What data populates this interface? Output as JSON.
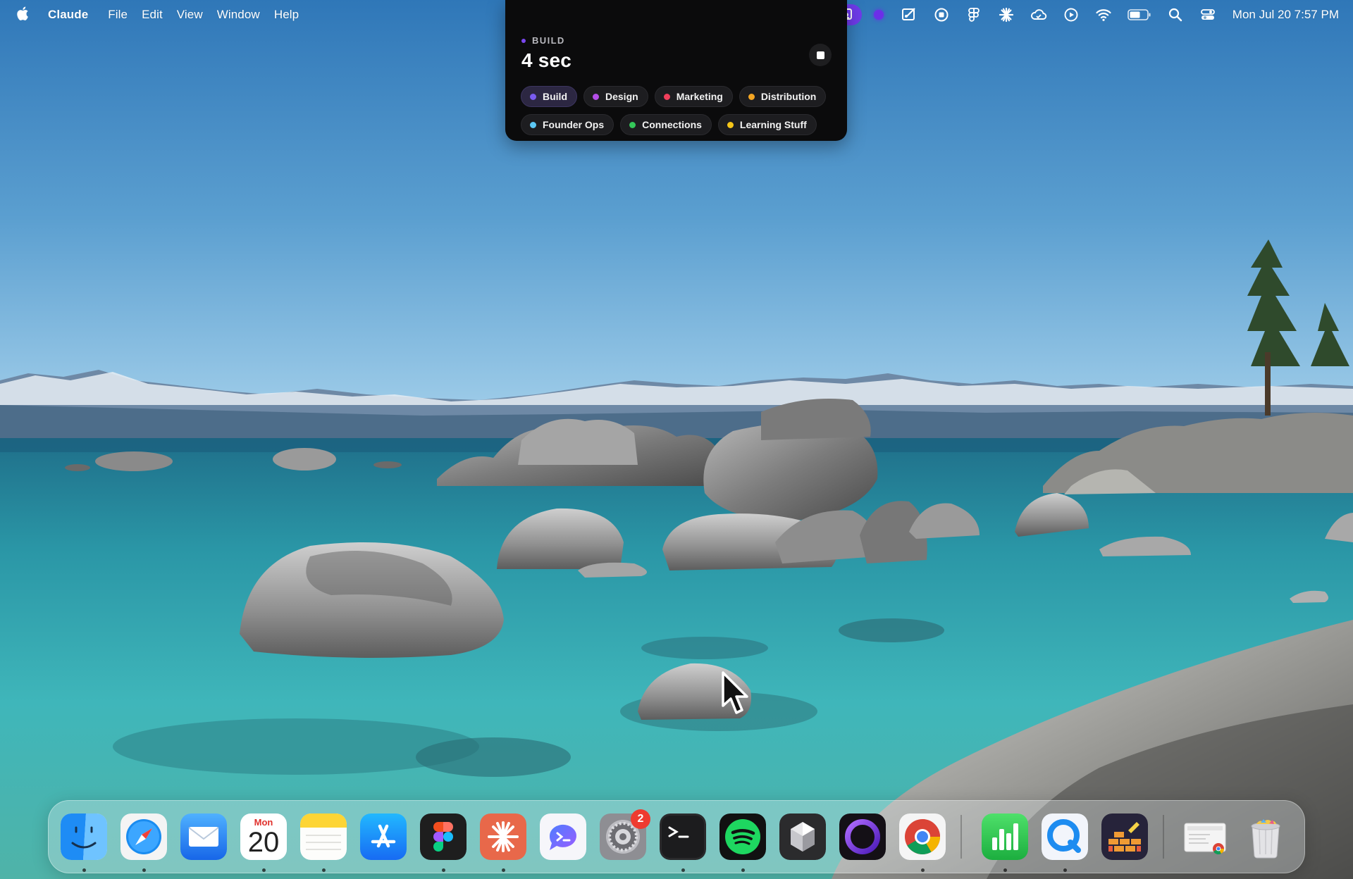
{
  "menubar": {
    "app_name": "Claude",
    "menus": [
      "File",
      "Edit",
      "View",
      "Window",
      "Help"
    ],
    "status_icons": [
      "screen-share-icon",
      "recording-dot-icon",
      "screenshot-tool-icon",
      "record-icon",
      "figma-icon",
      "claude-icon",
      "cloud-sync-icon",
      "play-icon",
      "wifi-icon",
      "battery-icon",
      "search-icon",
      "control-center-icon"
    ],
    "clock": "Mon Jul 20  7:57 PM"
  },
  "timer_widget": {
    "project_label": "BUILD",
    "elapsed": "4 sec",
    "tags": [
      {
        "label": "Build",
        "color": "#7a5cf0",
        "active": true
      },
      {
        "label": "Design",
        "color": "#b44ee8",
        "active": false
      },
      {
        "label": "Marketing",
        "color": "#f03f5b",
        "active": false
      },
      {
        "label": "Distribution",
        "color": "#f5a623",
        "active": false
      },
      {
        "label": "Founder Ops",
        "color": "#5cc8f5",
        "active": false
      },
      {
        "label": "Connections",
        "color": "#34c759",
        "active": false
      },
      {
        "label": "Learning Stuff",
        "color": "#f5c518",
        "active": false
      }
    ]
  },
  "dock": {
    "apps": [
      "Finder",
      "Safari",
      "Mail",
      "Calendar",
      "Notes",
      "App Store",
      "Figma",
      "Claude",
      "Messenger",
      "System Settings",
      "Terminal",
      "Spotify",
      "Linear",
      "Arc",
      "Chrome",
      "Numbers",
      "QuickTime",
      "Game",
      "Downloads",
      "Trash"
    ],
    "calendar": {
      "month": "Mon",
      "day": "20"
    },
    "settings_badge": "2"
  }
}
